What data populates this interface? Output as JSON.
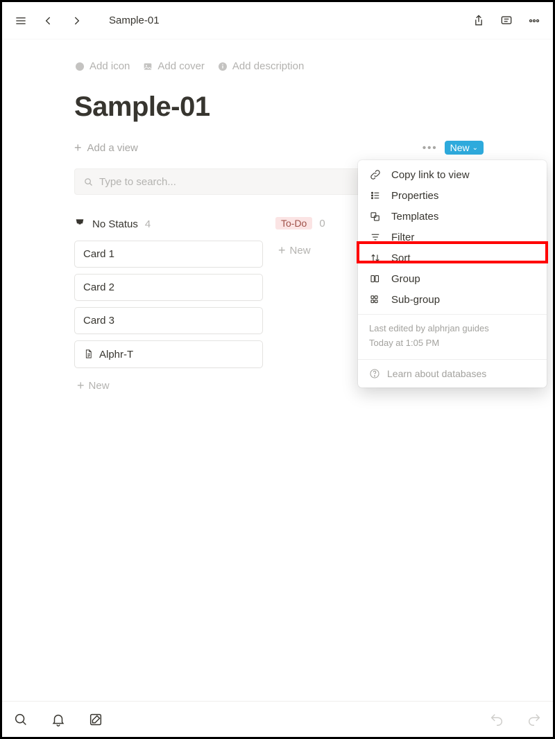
{
  "topbar": {
    "title": "Sample-01"
  },
  "page": {
    "title": "Sample-01",
    "actions": {
      "add_icon": "Add icon",
      "add_cover": "Add cover",
      "add_description": "Add description"
    }
  },
  "view": {
    "add_view": "Add a view",
    "new_label": "New"
  },
  "search": {
    "placeholder": "Type to search..."
  },
  "board": {
    "columns": [
      {
        "id": "no-status",
        "label": "No Status",
        "count": "4",
        "cards": [
          {
            "title": "Card 1",
            "has_icon": false
          },
          {
            "title": "Card 2",
            "has_icon": false
          },
          {
            "title": "Card 3",
            "has_icon": false
          },
          {
            "title": "Alphr-T",
            "has_icon": true
          }
        ],
        "add_new": "New"
      },
      {
        "id": "todo",
        "label": "To-Do",
        "count": "0",
        "cards": [],
        "add_new": "New"
      }
    ]
  },
  "menu": {
    "items": [
      {
        "id": "copy-link",
        "label": "Copy link to view",
        "icon": "link"
      },
      {
        "id": "properties",
        "label": "Properties",
        "icon": "properties"
      },
      {
        "id": "templates",
        "label": "Templates",
        "icon": "templates"
      },
      {
        "id": "filter",
        "label": "Filter",
        "icon": "filter"
      },
      {
        "id": "sort",
        "label": "Sort",
        "icon": "sort",
        "highlighted": true
      },
      {
        "id": "group",
        "label": "Group",
        "icon": "group"
      },
      {
        "id": "subgroup",
        "label": "Sub-group",
        "icon": "subgroup"
      }
    ],
    "edited_by": "Last edited by alphrjan guides",
    "edited_at": "Today at 1:05 PM",
    "learn": "Learn about databases"
  }
}
